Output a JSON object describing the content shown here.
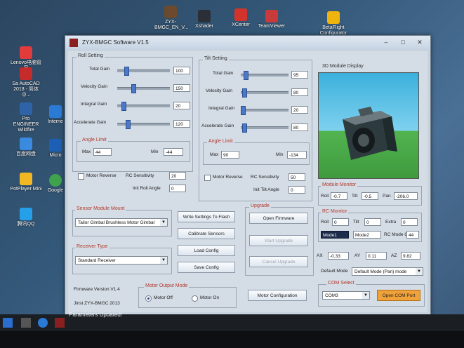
{
  "desktop": {
    "icons": [
      {
        "label": "Lenovo电脑管家"
      },
      {
        "label": "Sa AutoCAD 2018 - 简体中..."
      },
      {
        "label": "Pro ENGINEER Wildfire"
      },
      {
        "label": "百度网盘"
      },
      {
        "label": "PotPlayer Mini"
      },
      {
        "label": "腾讯QQ"
      },
      {
        "label": "Interne"
      },
      {
        "label": "Micro"
      },
      {
        "label": "Google"
      },
      {
        "label": "ZYX-BMGC_EN_V..."
      },
      {
        "label": "Xshader"
      },
      {
        "label": "XCenter"
      },
      {
        "label": "TeamViewer"
      },
      {
        "label": "BetaFlight Configurator"
      }
    ]
  },
  "window": {
    "title": "ZYX-BMGC Software V1.5",
    "pid_setting": {
      "label": "Roll Setting",
      "rows": [
        {
          "label": "Total Gain",
          "value": "100"
        },
        {
          "label": "Velocity Gain",
          "value": "150"
        },
        {
          "label": "Integral Gain",
          "value": "20"
        },
        {
          "label": "Accelerate Gain",
          "value": "120"
        }
      ]
    },
    "tilt_setting": {
      "label": "Tilt Setting",
      "rows": [
        {
          "label": "Total Gain",
          "value": "95"
        },
        {
          "label": "Velocity Gain",
          "value": "80"
        },
        {
          "label": "Integral Gain",
          "value": "20"
        },
        {
          "label": "Accelerate Gain",
          "value": "80"
        }
      ]
    },
    "angle_limit_roll": {
      "label": "Angle Limit",
      "max_label": "Max",
      "max": "44",
      "min_label": "Min",
      "min": "-44"
    },
    "angle_limit_tilt": {
      "label": "Angle Limit",
      "max_label": "Max",
      "max": "90",
      "min_label": "Min",
      "min": "-134"
    },
    "roll_opts": {
      "reverse_label": "Motor Reverse",
      "rc_sens_label": "RC Sensitivity",
      "rc_sens": "20",
      "init_label": "Init Roll Angle",
      "init": "0"
    },
    "tilt_opts": {
      "reverse_label": "Motor Reverse",
      "rc_sens_label": "RC Sensitivity",
      "rc_sens": "50",
      "init_label": "Init Tilt Angle",
      "init": "0"
    },
    "sensor_mount": {
      "label": "Sensor Module Mount",
      "value": "Tailor Gimbal Brushless Motor Gimbal"
    },
    "receiver": {
      "label": "Receiver Type",
      "value": "Standard Receiver"
    },
    "buttons": {
      "write_flash": "Write Settings To Flash",
      "calibrate": "Calibrate Sensors",
      "load_config": "Load Config",
      "save_config": "Save Config",
      "motor_config": "Motor Configuration"
    },
    "upgrade": {
      "label": "Upgrade",
      "open_firmware": "Open Firmware",
      "start_upgrade": "Start Upgrade",
      "cancel_upgrade": "Cancel Upgrade"
    },
    "motor_output": {
      "label": "Motor Output Mode",
      "off": "Motor Off",
      "on": "Motor On"
    },
    "footer": {
      "firmware": "Firmware Version V1.4",
      "copyright": "Jinst ZYX-BMGC 2013",
      "status": "Parameters Updated!"
    },
    "view3d": {
      "label": "3D Module Display"
    },
    "module_monitor": {
      "label": "Module Monitor",
      "roll_label": "Roll",
      "roll": "-0.7",
      "tilt_label": "Tilt",
      "tilt": "-0.5",
      "pan_label": "Pan",
      "pan": "-206.0"
    },
    "rc_monitor": {
      "label": "RC Monitor",
      "roll_label": "Roll",
      "roll": "0",
      "tilt_label": "Tilt",
      "tilt": "0",
      "extra_label": "Extra",
      "extra": "0",
      "mode1": "Mode1",
      "mode2": "Mode2",
      "rc_mode_label": "RC Mode C",
      "rc_mode": "44"
    },
    "acc": {
      "ax_label": "AX",
      "ax": "-0.33",
      "ay_label": "AY",
      "ay": "0.11",
      "az_label": "AZ",
      "az": "9.82"
    },
    "default_mode": {
      "label": "Default Mode",
      "value": "Default Mode (Pan) mode"
    },
    "com": {
      "label": "COM Select",
      "value": "COM3",
      "open": "Open COM Port"
    }
  }
}
